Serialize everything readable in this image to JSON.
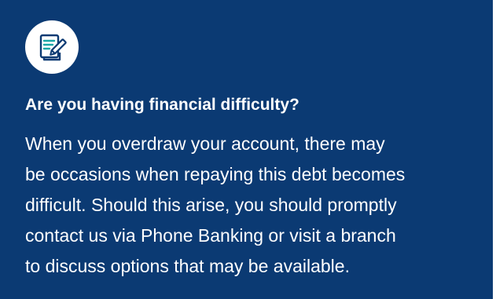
{
  "card": {
    "icon": "document-edit-icon",
    "title": "Are you having financial difficulty?",
    "body_lines": [
      "When you overdraw your account, there may",
      "be occasions when repaying this debt becomes",
      "difficult. Should this arise, you should promptly",
      "contact us via Phone Banking or visit a branch",
      "to discuss options that may be available."
    ],
    "colors": {
      "background": "#0b3a73",
      "text": "#ffffff",
      "icon_accent": "#1aa7a7",
      "icon_ink": "#0b3a73"
    }
  }
}
